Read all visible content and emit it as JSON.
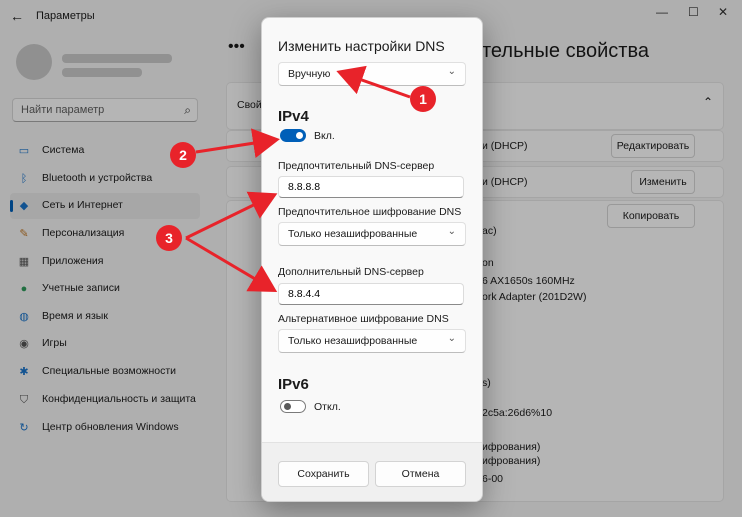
{
  "window": {
    "title": "Параметры",
    "back_glyph": "←",
    "controls": [
      "—",
      "☐",
      "✕"
    ]
  },
  "search": {
    "placeholder": "Найти параметр"
  },
  "sidebar": {
    "items": [
      {
        "label": "Система",
        "icon": "monitor-icon"
      },
      {
        "label": "Bluetooth и устройства",
        "icon": "bluetooth-icon"
      },
      {
        "label": "Сеть и Интернет",
        "icon": "wifi-icon",
        "active": true
      },
      {
        "label": "Персонализация",
        "icon": "brush-icon"
      },
      {
        "label": "Приложения",
        "icon": "apps-icon"
      },
      {
        "label": "Учетные записи",
        "icon": "person-icon"
      },
      {
        "label": "Время и язык",
        "icon": "globe-icon"
      },
      {
        "label": "Игры",
        "icon": "gamepad-icon"
      },
      {
        "label": "Специальные возможности",
        "icon": "accessibility-icon"
      },
      {
        "label": "Конфиденциальность и защита",
        "icon": "shield-icon"
      },
      {
        "label": "Центр обновления Windows",
        "icon": "update-icon"
      }
    ]
  },
  "header": {
    "more": "•••",
    "title_fragment": "тельные свойства"
  },
  "background_panel": {
    "section": "Свой",
    "rows": [
      {
        "text": "и (DHCP)",
        "button": "Редактировать"
      },
      {
        "text": "и (DHCP)",
        "button": "Изменить"
      },
      {
        "text": "",
        "button": "Копировать"
      }
    ],
    "details": [
      "ac)",
      "on",
      "6 AX1650s 160MHz",
      "ork Adapter (201D2W)",
      "s)",
      "2c5a:26d6%10",
      "ифрования)",
      "ифрования)",
      "6-00"
    ]
  },
  "dialog": {
    "title": "Изменить настройки DNS",
    "mode_value": "Вручную",
    "ipv4": {
      "heading": "IPv4",
      "toggle_label": "Вкл.",
      "toggle_on": true,
      "preferred_label": "Предпочтительный DNS-сервер",
      "preferred_value": "8.8.8.8",
      "preferred_enc_label": "Предпочтительное шифрование DNS",
      "preferred_enc_value": "Только незашифрованные",
      "alternate_label": "Дополнительный DNS-сервер",
      "alternate_value": "8.8.4.4",
      "alternate_enc_label": "Альтернативное шифрование DNS",
      "alternate_enc_value": "Только незашифрованные"
    },
    "ipv6": {
      "heading": "IPv6",
      "toggle_label": "Откл.",
      "toggle_on": false
    },
    "save_label": "Сохранить",
    "cancel_label": "Отмена"
  },
  "annotations": {
    "badges": [
      "1",
      "2",
      "3"
    ],
    "color": "#e8232a"
  },
  "colors": {
    "accent": "#005fb8",
    "annotation": "#e8232a"
  }
}
